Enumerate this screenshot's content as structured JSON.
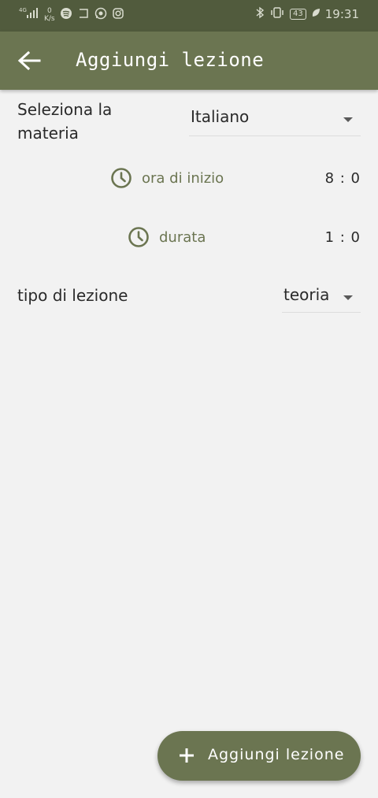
{
  "status_bar": {
    "network": "4G",
    "net_speed_value": "0",
    "net_speed_unit": "K/s",
    "battery": "43",
    "time": "19:31"
  },
  "app_bar": {
    "title": "Aggiungi lezione",
    "back_icon": "arrow-left-icon"
  },
  "form": {
    "materia_label": "Seleziona la materia",
    "materia_value": "Italiano",
    "start_label": "ora di inizio",
    "start_value": "8 : 0",
    "duration_label": "durata",
    "duration_value": "1 : 0",
    "tipo_label": "tipo di lezione",
    "tipo_value": "teoria"
  },
  "fab": {
    "label": "Aggiungi lezione",
    "icon": "plus-icon"
  },
  "colors": {
    "status_bar": "#515b3d",
    "app_bar": "#6b7551",
    "accent": "#6b7551",
    "background": "#f2f2f2"
  }
}
